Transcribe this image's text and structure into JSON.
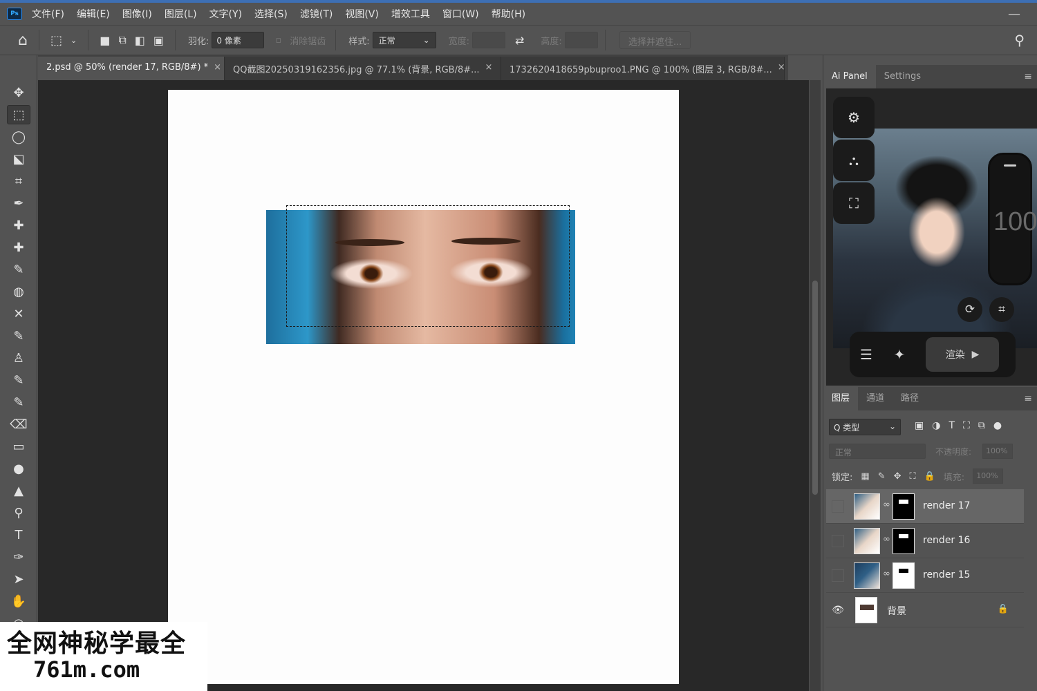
{
  "menubar": {
    "logo": "Ps",
    "items": [
      "文件(F)",
      "编辑(E)",
      "图像(I)",
      "图层(L)",
      "文字(Y)",
      "选择(S)",
      "滤镜(T)",
      "视图(V)",
      "增效工具",
      "窗口(W)",
      "帮助(H)"
    ],
    "minimize": "—"
  },
  "options": {
    "home_icon": "⌂",
    "marquee_icon": "⬚",
    "feather_label": "羽化:",
    "feather_value": "0 像素",
    "antialias_label": "消除锯齿",
    "style_label": "样式:",
    "style_value": "正常",
    "width_label": "宽度:",
    "swap_icon": "⇄",
    "height_label": "高度:",
    "select_mask_button": "选择并遮住..."
  },
  "tabs": [
    {
      "label": "2.psd @ 50% (render 17, RGB/8#) *",
      "close": "×"
    },
    {
      "label": "QQ截图20250319162356.jpg @ 77.1% (背景, RGB/8#...",
      "close": "×"
    },
    {
      "label": "1732620418659pbuproo1.PNG @ 100% (图层 3, RGB/8#...",
      "close": "×"
    }
  ],
  "tools": [
    "✥",
    "⬚",
    "◯",
    "⬕",
    "⌗",
    "✒",
    "✚",
    "✚",
    "✎",
    "◍",
    "✕",
    "✎",
    "♙",
    "✎",
    "✎",
    "⌫",
    "▭",
    "●",
    "▲",
    "⚲",
    "T",
    "✑",
    "➤",
    "✋",
    "○"
  ],
  "ai_panel": {
    "tabs": [
      "Ai Panel",
      "Settings"
    ],
    "menu_icon": "≡",
    "side_buttons": [
      "⚙",
      "⛬",
      "⛶"
    ],
    "slider_value": "100",
    "rotate_icon": "⟳",
    "crop_icon": "⌗",
    "list_icon": "☰",
    "sparkle_icon": "✦",
    "render_label": "渲染",
    "play_icon": "▶"
  },
  "layers_panel": {
    "tabs": [
      "图层",
      "通道",
      "路径"
    ],
    "menu_icon": "≡",
    "filter_label": "Q 类型",
    "filter_icons": [
      "▣",
      "◑",
      "T",
      "⛶",
      "⧉"
    ],
    "blend_mode": "正常",
    "opacity_label": "不透明度:",
    "opacity_value": "100%",
    "lock_label": "锁定:",
    "lock_icons": [
      "▦",
      "✎",
      "✥",
      "⛶",
      "🔒"
    ],
    "fill_label": "填充:",
    "fill_value": "100%",
    "layers": [
      {
        "name": "render 17",
        "link": "∞"
      },
      {
        "name": "render 16",
        "link": "∞"
      },
      {
        "name": "render 15",
        "link": "∞"
      }
    ],
    "background_layer": {
      "name": "背景",
      "visible_icon": "👁",
      "lock_icon": "🔒"
    }
  },
  "watermark": {
    "line1": "全网神秘学最全",
    "line2": "761m.com"
  }
}
